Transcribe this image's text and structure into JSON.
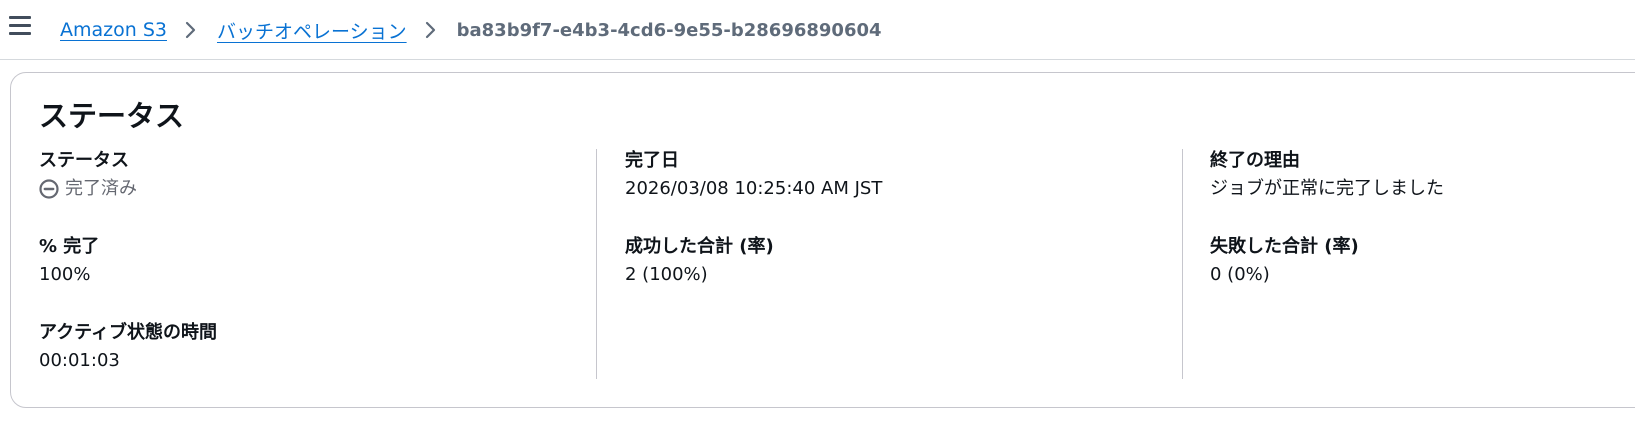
{
  "header": {
    "menu_icon": "hamburger-menu-icon",
    "breadcrumbs": [
      {
        "label": "Amazon S3",
        "link": true
      },
      {
        "label": "バッチオペレーション",
        "link": true
      },
      {
        "label": "ba83b9f7-e4b3-4cd6-9e55-b28696890604",
        "link": false
      }
    ],
    "separator_icon": "chevron-right-icon"
  },
  "panel": {
    "title": "ステータス",
    "columns": [
      {
        "fields": [
          {
            "label": "ステータス",
            "value": "完了済み",
            "icon": "stopped-status-icon",
            "value_color": "#656871"
          },
          {
            "label": "% 完了",
            "value": "100%"
          },
          {
            "label": "アクティブ状態の時間",
            "value": "00:01:03"
          }
        ]
      },
      {
        "fields": [
          {
            "label": "完了日",
            "value": "2026/03/08 10:25:40 AM JST"
          },
          {
            "label": "成功した合計 (率)",
            "value": "2 (100%)"
          }
        ]
      },
      {
        "fields": [
          {
            "label": "終了の理由",
            "value": "ジョブが正常に完了しました"
          },
          {
            "label": "失敗した合計 (率)",
            "value": "0 (0%)"
          }
        ]
      }
    ]
  },
  "colors": {
    "link": "#0972d3",
    "text": "#0f141a",
    "muted": "#5f6b7a",
    "border": "#c6c6cd"
  }
}
